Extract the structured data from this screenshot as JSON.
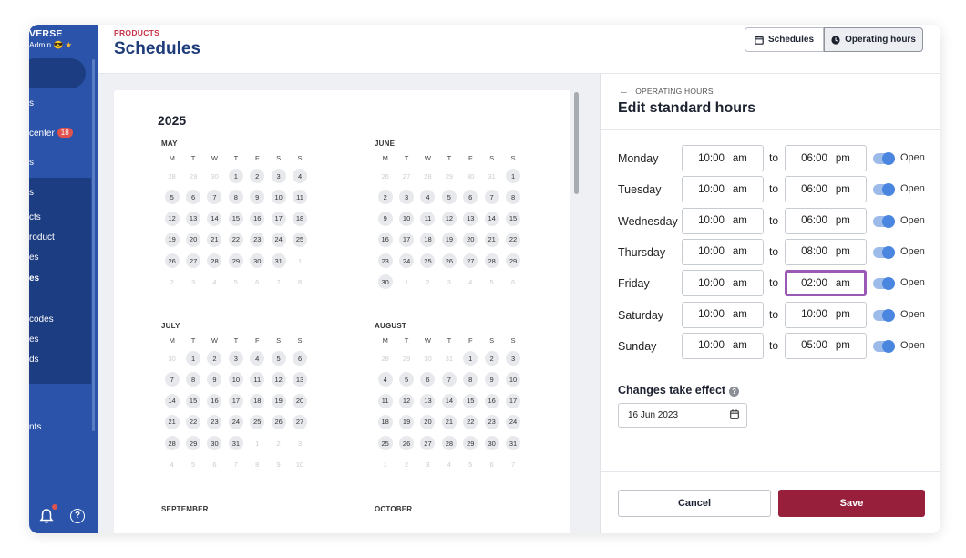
{
  "sidebar": {
    "brand": "VERSE",
    "role": "Admin",
    "items": [
      {
        "label": "s"
      },
      {
        "label": "center",
        "badge": "18"
      },
      {
        "label": "s"
      },
      {
        "label": "s"
      },
      {
        "label": "cts"
      },
      {
        "label": "roduct"
      },
      {
        "label": "es"
      },
      {
        "label": "es"
      },
      {
        "label": "codes"
      },
      {
        "label": "es"
      },
      {
        "label": "ds"
      },
      {
        "label": "nts"
      }
    ],
    "help_glyph": "?"
  },
  "header": {
    "breadcrumb": "PRODUCTS",
    "title": "Schedules",
    "toggle": {
      "schedules_label": "Schedules",
      "operating_hours_label": "Operating hours",
      "active": "Operating hours"
    }
  },
  "calendar": {
    "year": "2025",
    "dow": [
      "M",
      "T",
      "W",
      "T",
      "F",
      "S",
      "S"
    ],
    "months": [
      {
        "name": "MAY",
        "lead": [
          28,
          29,
          30
        ],
        "days": 31,
        "trail": [
          1,
          2,
          3,
          4,
          5,
          6,
          7,
          8
        ],
        "lead_out": true
      },
      {
        "name": "JUNE",
        "lead": [
          26,
          27,
          28,
          29,
          30,
          31
        ],
        "days": 30,
        "trail": [
          1,
          2,
          3,
          4,
          5,
          6
        ]
      },
      {
        "name": "JULY",
        "lead": [
          30
        ],
        "days": 31,
        "trail": [
          1,
          2,
          3,
          4,
          5,
          6,
          7,
          8,
          9,
          10
        ]
      },
      {
        "name": "AUGUST",
        "lead": [
          28,
          29,
          30,
          31
        ],
        "days": 31,
        "trail": [
          1,
          2,
          3,
          4,
          5,
          6,
          7
        ]
      },
      {
        "name": "SEPTEMBER"
      },
      {
        "name": "OCTOBER"
      }
    ]
  },
  "panel": {
    "back_label": "OPERATING HOURS",
    "title": "Edit standard hours",
    "to_label": "to",
    "open_label": "Open",
    "days": [
      {
        "day": "Monday",
        "open_time": "10:00",
        "open_ampm": "am",
        "close_time": "06:00",
        "close_ampm": "pm",
        "is_open": true
      },
      {
        "day": "Tuesday",
        "open_time": "10:00",
        "open_ampm": "am",
        "close_time": "06:00",
        "close_ampm": "pm",
        "is_open": true
      },
      {
        "day": "Wednesday",
        "open_time": "10:00",
        "open_ampm": "am",
        "close_time": "06:00",
        "close_ampm": "pm",
        "is_open": true
      },
      {
        "day": "Thursday",
        "open_time": "10:00",
        "open_ampm": "am",
        "close_time": "08:00",
        "close_ampm": "pm",
        "is_open": true
      },
      {
        "day": "Friday",
        "open_time": "10:00",
        "open_ampm": "am",
        "close_time": "02:00",
        "close_ampm": "am",
        "is_open": true,
        "highlight": "close"
      },
      {
        "day": "Saturday",
        "open_time": "10:00",
        "open_ampm": "am",
        "close_time": "10:00",
        "close_ampm": "pm",
        "is_open": true
      },
      {
        "day": "Sunday",
        "open_time": "10:00",
        "open_ampm": "am",
        "close_time": "05:00",
        "close_ampm": "pm",
        "is_open": true
      }
    ],
    "effect_label": "Changes take effect",
    "effect_date": "16 Jun 2023",
    "cancel_label": "Cancel",
    "save_label": "Save"
  },
  "colors": {
    "sidebar": "#2a53a9",
    "accent": "#981f3c",
    "title": "#1f3c7a",
    "highlight": "#9b59b6",
    "toggle": "#4a86e0"
  }
}
